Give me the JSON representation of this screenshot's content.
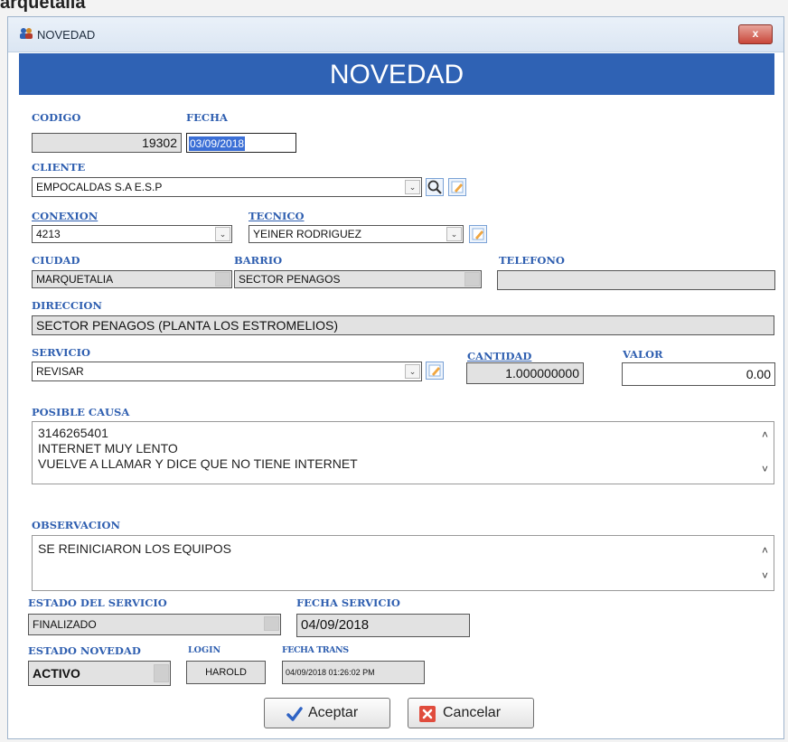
{
  "page_top_text": "arquetalia",
  "window": {
    "title": "NOVEDAD",
    "close_label": "x"
  },
  "banner_title": "NOVEDAD",
  "labels": {
    "codigo": "CODIGO",
    "fecha": "FECHA",
    "cliente": "CLIENTE",
    "conexion": "CONEXION",
    "tecnico": "TECNICO",
    "ciudad": "CIUDAD",
    "barrio": "BARRIO",
    "telefono": "TELEFONO",
    "direccion": "DIRECCION",
    "servicio": "SERVICIO",
    "cantidad": "CANTIDAD",
    "valor": "VALOR",
    "posible_causa": "POSIBLE CAUSA",
    "observacion": "OBSERVACION",
    "estado_servicio": "ESTADO DEL SERVICIO",
    "fecha_servicio": "FECHA SERVICIO",
    "estado_novedad": "ESTADO NOVEDAD",
    "login": "LOGIN",
    "fecha_trans": "FECHA TRANS"
  },
  "fields": {
    "codigo": "19302",
    "fecha": "03/09/2018",
    "cliente": "EMPOCALDAS S.A  E.S.P",
    "conexion": "4213",
    "tecnico": "YEINER RODRIGUEZ",
    "ciudad": "MARQUETALIA",
    "barrio": "SECTOR PENAGOS",
    "telefono": "",
    "direccion": "SECTOR PENAGOS (PLANTA LOS ESTROMELIOS)",
    "servicio": "REVISAR",
    "cantidad": "1.000000000",
    "valor": "0.00",
    "posible_causa": [
      "3146265401",
      "INTERNET MUY LENTO",
      "VUELVE A LLAMAR Y DICE QUE NO TIENE INTERNET"
    ],
    "observacion": [
      "SE REINICIARON LOS EQUIPOS"
    ],
    "estado_servicio": "FINALIZADO",
    "fecha_servicio": "04/09/2018",
    "estado_novedad": "ACTIVO",
    "login": "HAROLD",
    "fecha_trans": "04/09/2018 01:26:02 PM"
  },
  "buttons": {
    "aceptar": "Aceptar",
    "cancelar": "Cancelar"
  },
  "icons": {
    "title": "users-icon",
    "search": "magnifier-icon",
    "edit": "edit-icon",
    "dropdown": "chevron-down-icon",
    "accept": "check-icon",
    "cancel": "x-icon"
  },
  "colors": {
    "banner": "#2f62b4",
    "label": "#2f5fb0",
    "selection": "#3b6fd6"
  }
}
